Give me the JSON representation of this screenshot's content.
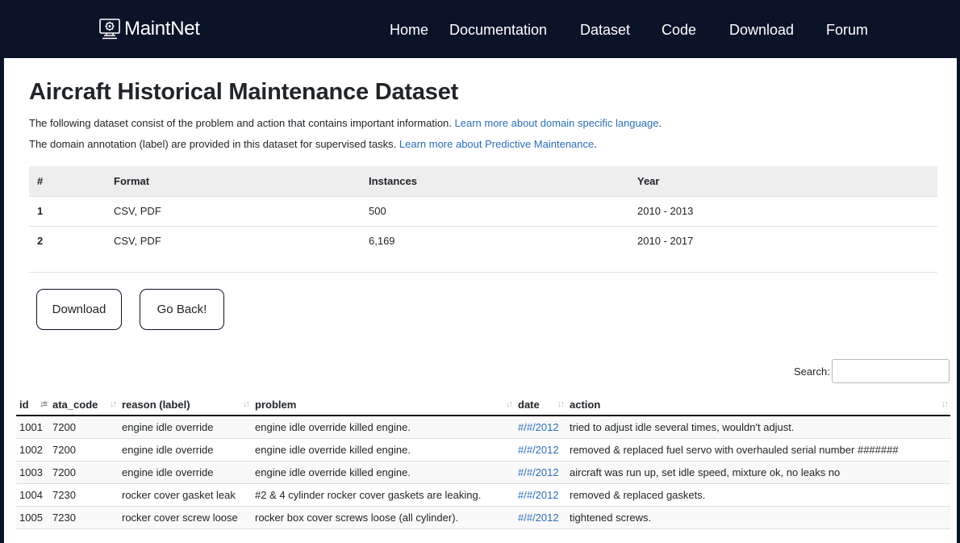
{
  "nav": {
    "brand": "MaintNet",
    "items": [
      "Home",
      "Documentation",
      "Dataset",
      "Code",
      "Download",
      "Forum"
    ]
  },
  "page": {
    "title": "Aircraft Historical Maintenance Dataset",
    "intro1": {
      "text": "The following dataset consist of the problem and action that contains important information. ",
      "link": "Learn more about domain specific language",
      "end": "."
    },
    "intro2": {
      "text": "The domain annotation (label) are provided in this dataset for supervised tasks. ",
      "link": "Learn more about Predictive Maintenance",
      "end": "."
    }
  },
  "meta_table": {
    "headers": [
      "#",
      "Format",
      "Instances",
      "Year"
    ],
    "rows": [
      [
        "1",
        "CSV, PDF",
        "500",
        "2010 - 2013"
      ],
      [
        "2",
        "CSV, PDF",
        "6,169",
        "2010 - 2017"
      ]
    ]
  },
  "buttons": {
    "download": "Download",
    "back": "Go Back!"
  },
  "search": {
    "label": "Search:",
    "value": "",
    "placeholder": ""
  },
  "data_table": {
    "headers": [
      "id",
      "ata_code",
      "reason (label)",
      "problem",
      "date",
      "action"
    ],
    "sort_icons": {
      "sorted_asc": "↓≡",
      "unsorted": "↓↑"
    },
    "rows": [
      [
        "1001",
        "7200",
        "engine idle override",
        "engine idle override killed engine.",
        "#/#/2012",
        "tried to adjust idle several times, wouldn't adjust."
      ],
      [
        "1002",
        "7200",
        "engine idle override",
        "engine idle override killed engine.",
        "#/#/2012",
        "removed & replaced fuel servo with overhauled serial number #######"
      ],
      [
        "1003",
        "7200",
        "engine idle override",
        "engine idle override killed engine.",
        "#/#/2012",
        "aircraft was run up, set idle speed, mixture ok, no leaks no"
      ],
      [
        "1004",
        "7230",
        "rocker cover gasket leak",
        "#2 & 4 cylinder rocker cover gaskets are leaking.",
        "#/#/2012",
        "removed & replaced gaskets."
      ],
      [
        "1005",
        "7230",
        "rocker cover screw loose",
        "rocker box cover screws loose (all cylinder).",
        "#/#/2012",
        "tightened screws."
      ]
    ]
  },
  "colors": {
    "nav_bg": "#0b1329",
    "link": "#2a6fb6",
    "header_bg": "#eeeeee"
  }
}
